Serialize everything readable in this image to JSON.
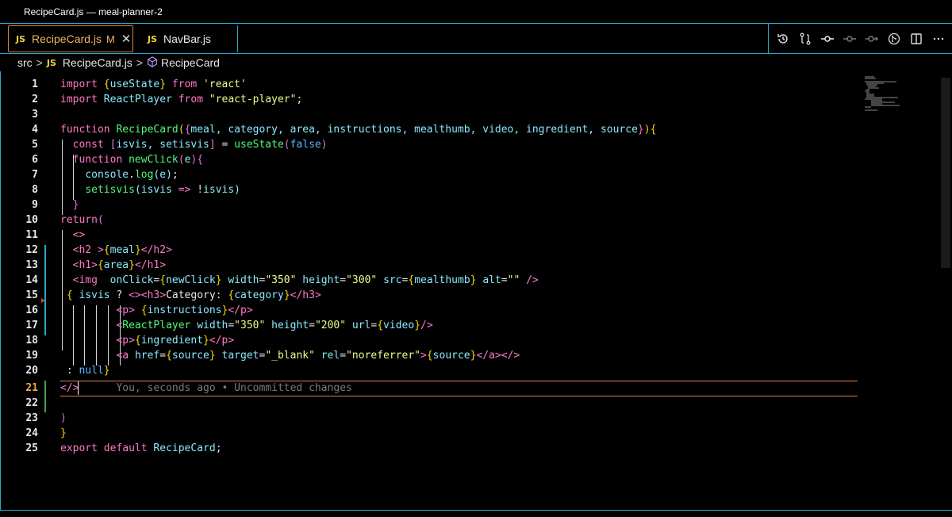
{
  "window": {
    "title": "RecipeCard.js — meal-planner-2"
  },
  "tabs": [
    {
      "badge": "JS",
      "label": "RecipeCard.js",
      "modified": "M",
      "close": "✕"
    },
    {
      "badge": "JS",
      "label": "NavBar.js"
    }
  ],
  "toolbar_icons": [
    "history-icon",
    "compare-changes-icon",
    "commit-icon",
    "previous-change-icon",
    "next-change-icon",
    "git-graph-icon",
    "split-editor-icon",
    "more-icon"
  ],
  "breadcrumb": {
    "folder": "src",
    "file_badge": "JS",
    "file": "RecipeCard.js",
    "symbol": "RecipeCard"
  },
  "editor": {
    "current_line": "21",
    "blame_text": "You, seconds ago • Uncommitted changes",
    "line_numbers": [
      "1",
      "2",
      "3",
      "4",
      "5",
      "6",
      "7",
      "8",
      "9",
      "10",
      "11",
      "12",
      "13",
      "14",
      "15",
      "16",
      "17",
      "18",
      "19",
      "20",
      "21",
      "22",
      "23",
      "24",
      "25"
    ]
  },
  "colors": {
    "accent": "#2aa7c9",
    "active_tab": "#e0803a",
    "keyword": "#ff79c6",
    "string": "#f1fa8c",
    "bracket": "#f1d700"
  }
}
